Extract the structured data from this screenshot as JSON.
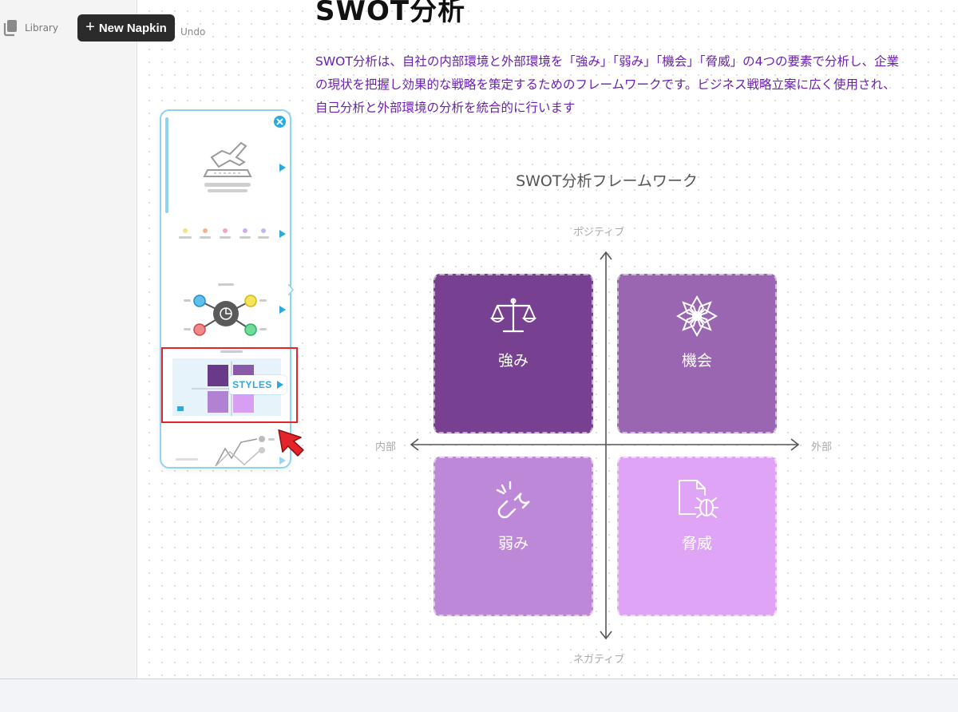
{
  "sidebar": {
    "library_label": "Library",
    "new_napkin_label": "New Napkin"
  },
  "toolbar": {
    "undo_label": "Undo"
  },
  "document": {
    "title": "SWOT分析",
    "description": "SWOT分析は、自社の内部環境と外部環境を「強み」「弱み」「機会」「脅威」の4つの要素で分析し、企業の現状を把握し効果的な戦略を策定するためのフレームワークです。ビジネス戦略立案に広く使用され、自己分析と外部環境の分析を統合的に行います"
  },
  "style_picker": {
    "styles_label": "STYLES"
  },
  "diagram": {
    "title": "SWOT分析フレームワーク",
    "axis": {
      "top": "ポジティブ",
      "bottom": "ネガティブ",
      "left": "内部",
      "right": "外部"
    },
    "quadrants": [
      {
        "label": "強み",
        "icon": "balance-scale-icon",
        "color": "#784090"
      },
      {
        "label": "機会",
        "icon": "snowflake-flower-icon",
        "color": "#9a66b2"
      },
      {
        "label": "弱み",
        "icon": "broken-chain-icon",
        "color": "#be88d8"
      },
      {
        "label": "脅威",
        "icon": "document-bug-icon",
        "color": "#e0a4f6"
      }
    ]
  },
  "colors": {
    "accent_blue": "#2aa8e0",
    "highlight_red": "#e3242b",
    "description_purple": "#6a1fb0"
  }
}
